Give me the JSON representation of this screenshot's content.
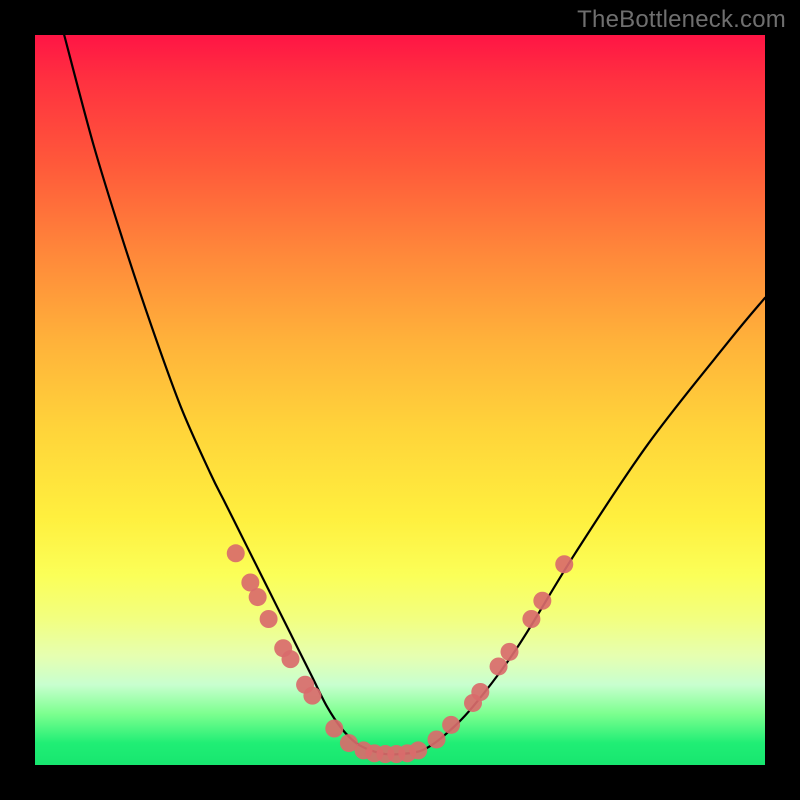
{
  "watermark": "TheBottleneck.com",
  "chart_data": {
    "type": "line",
    "title": "",
    "xlabel": "",
    "ylabel": "",
    "xlim": [
      0,
      100
    ],
    "ylim": [
      0,
      100
    ],
    "grid": false,
    "legend": false,
    "series": [
      {
        "name": "bottleneck-curve",
        "x": [
          4,
          8,
          12,
          16,
          20,
          24,
          26,
          28,
          30,
          32,
          34,
          36,
          38,
          40,
          42,
          44,
          46,
          48,
          50,
          53,
          56,
          60,
          66,
          74,
          84,
          95,
          100
        ],
        "y": [
          100,
          85,
          72,
          60,
          49,
          40,
          36,
          32,
          28,
          24,
          20,
          16,
          12,
          8,
          5,
          3,
          2,
          1.5,
          1.5,
          2,
          4,
          8,
          16,
          29,
          44,
          58,
          64
        ]
      }
    ],
    "markers": [
      {
        "x": 27.5,
        "y": 29
      },
      {
        "x": 29.5,
        "y": 25
      },
      {
        "x": 30.5,
        "y": 23
      },
      {
        "x": 32.0,
        "y": 20
      },
      {
        "x": 34.0,
        "y": 16
      },
      {
        "x": 35.0,
        "y": 14.5
      },
      {
        "x": 37.0,
        "y": 11
      },
      {
        "x": 38.0,
        "y": 9.5
      },
      {
        "x": 41.0,
        "y": 5
      },
      {
        "x": 43.0,
        "y": 3
      },
      {
        "x": 45.0,
        "y": 2
      },
      {
        "x": 46.5,
        "y": 1.6
      },
      {
        "x": 48.0,
        "y": 1.5
      },
      {
        "x": 49.5,
        "y": 1.5
      },
      {
        "x": 51.0,
        "y": 1.6
      },
      {
        "x": 52.5,
        "y": 2
      },
      {
        "x": 55.0,
        "y": 3.5
      },
      {
        "x": 57.0,
        "y": 5.5
      },
      {
        "x": 60.0,
        "y": 8.5
      },
      {
        "x": 61.0,
        "y": 10
      },
      {
        "x": 63.5,
        "y": 13.5
      },
      {
        "x": 65.0,
        "y": 15.5
      },
      {
        "x": 68.0,
        "y": 20
      },
      {
        "x": 69.5,
        "y": 22.5
      },
      {
        "x": 72.5,
        "y": 27.5
      }
    ],
    "colors": {
      "curve": "#000000",
      "marker_fill": "#d96b6b",
      "marker_stroke": "#d96b6b"
    }
  }
}
